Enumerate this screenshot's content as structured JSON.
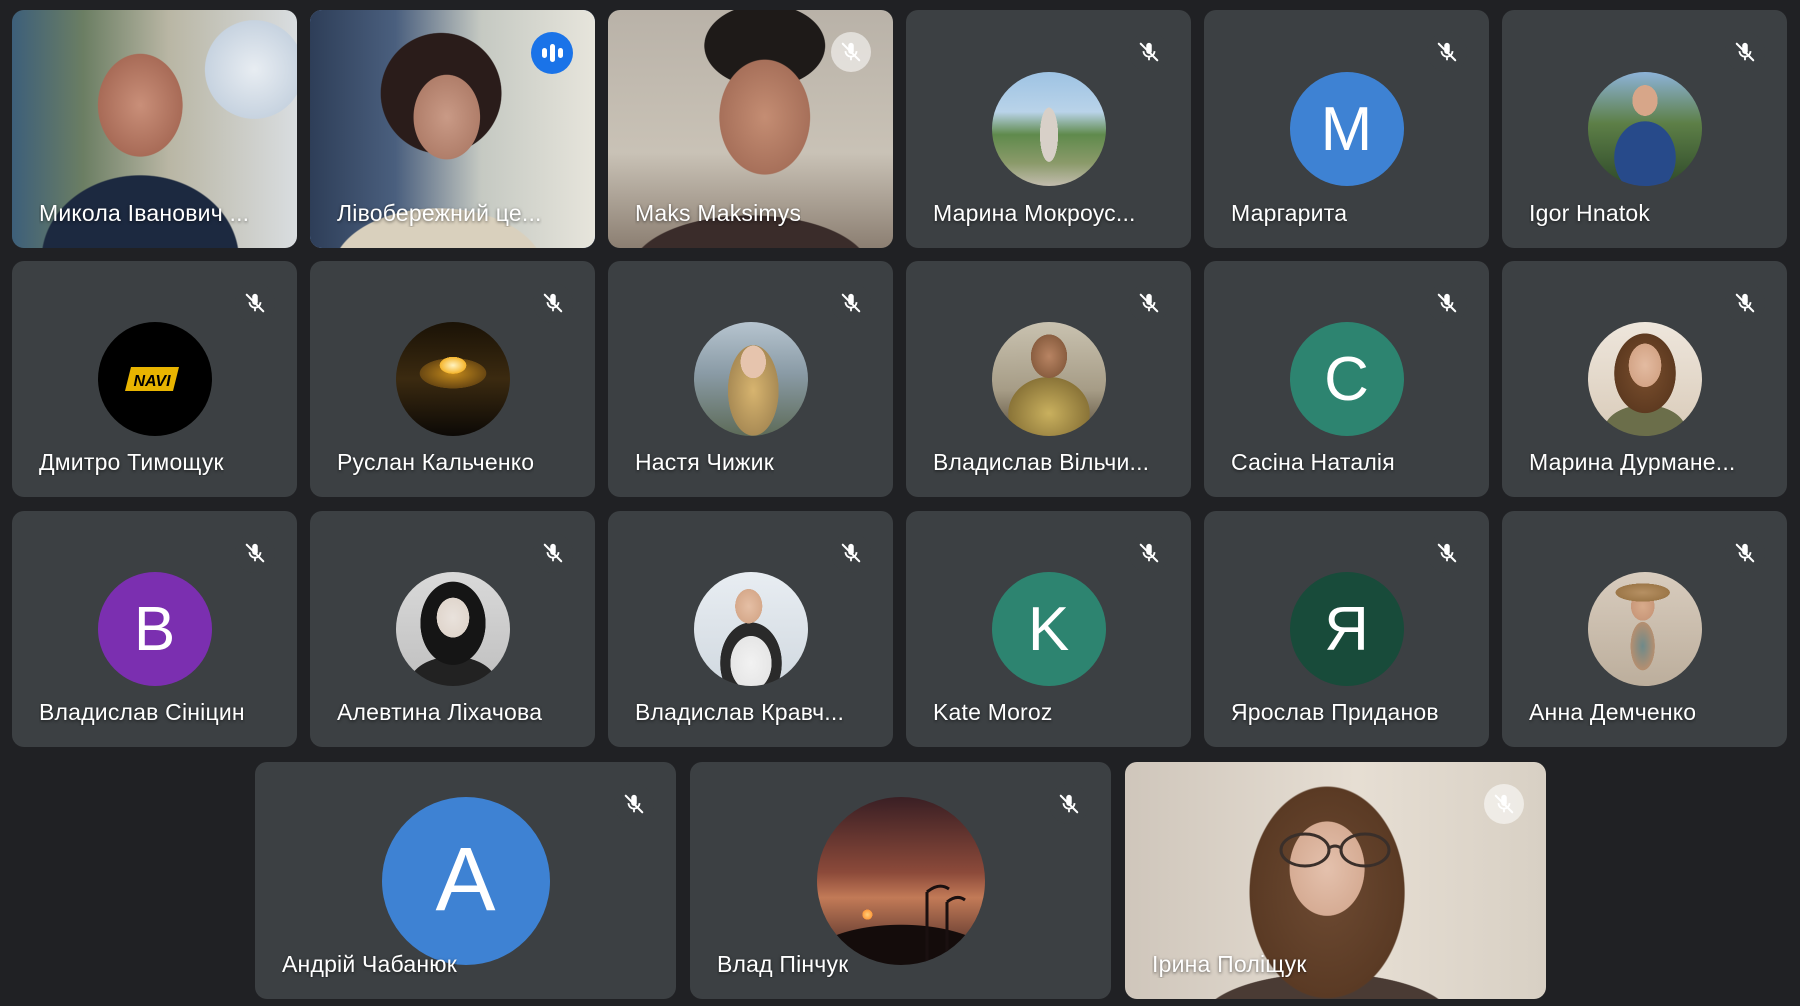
{
  "participants": [
    {
      "name": "Микола Іванович ...",
      "type": "video",
      "muted": false,
      "speaking": false,
      "icon": "man-in-suit-video"
    },
    {
      "name": "Лівобережний це...",
      "type": "video",
      "muted": false,
      "speaking": true,
      "icon": "woman-speaking-video"
    },
    {
      "name": "Maks Maksimys",
      "type": "video",
      "muted": true,
      "speaking": false,
      "icon": "man-with-glasses-video"
    },
    {
      "name": "Марина Мокроус...",
      "type": "photo",
      "muted": true,
      "speaking": false,
      "icon": "woman-on-path-photo",
      "color": "#6a8f5a"
    },
    {
      "name": "Маргарита",
      "type": "letter",
      "letter": "М",
      "muted": true,
      "speaking": false,
      "color": "#3e82d3"
    },
    {
      "name": "Igor Hnatok",
      "type": "photo",
      "muted": true,
      "speaking": false,
      "icon": "man-in-blue-suit-photo",
      "color": "#2f4a6a"
    },
    {
      "name": "Дмитро Тимощук",
      "type": "photo",
      "muted": true,
      "speaking": false,
      "icon": "navi-logo-photo",
      "color": "#000000"
    },
    {
      "name": "Руслан Кальченко",
      "type": "photo",
      "muted": true,
      "speaking": false,
      "icon": "car-headlight-photo",
      "color": "#3a2a10"
    },
    {
      "name": "Настя Чижик",
      "type": "photo",
      "muted": true,
      "speaking": false,
      "icon": "girl-by-lake-photo",
      "color": "#8a9ba6"
    },
    {
      "name": "Владислав Вільчи...",
      "type": "photo",
      "muted": true,
      "speaking": false,
      "icon": "bearded-man-photo",
      "color": "#7d6436"
    },
    {
      "name": "Сасіна Наталія",
      "type": "letter",
      "letter": "С",
      "muted": true,
      "speaking": false,
      "color": "#2d8470"
    },
    {
      "name": "Марина Дурмане...",
      "type": "photo",
      "muted": true,
      "speaking": false,
      "icon": "girl-portrait-photo",
      "color": "#b89a7c"
    },
    {
      "name": "Владислав Сініцин",
      "type": "letter",
      "letter": "В",
      "muted": true,
      "speaking": false,
      "color": "#7b2fb0"
    },
    {
      "name": "Алевтина Ліхачова",
      "type": "photo",
      "muted": true,
      "speaking": false,
      "icon": "girl-school-uniform-photo",
      "color": "#c9c9c9"
    },
    {
      "name": "Владислав Кравч...",
      "type": "photo",
      "muted": true,
      "speaking": false,
      "icon": "young-man-jacket-photo",
      "color": "#d6dde4"
    },
    {
      "name": "Kate Moroz",
      "type": "letter",
      "letter": "K",
      "muted": true,
      "speaking": false,
      "color": "#2d8470"
    },
    {
      "name": "Ярослав Приданов",
      "type": "letter",
      "letter": "Я",
      "muted": true,
      "speaking": false,
      "color": "#184b3a"
    },
    {
      "name": "Анна Демченко",
      "type": "photo",
      "muted": true,
      "speaking": false,
      "icon": "girl-with-hat-photo",
      "color": "#c4b6a4"
    },
    {
      "name": "Андрій Чабанюк",
      "type": "letter",
      "letter": "A",
      "muted": true,
      "speaking": false,
      "color": "#3e82d3"
    },
    {
      "name": "Влад Пінчук",
      "type": "photo",
      "muted": true,
      "speaking": false,
      "icon": "sunset-street-lamps-photo",
      "color": "#5a2c22"
    },
    {
      "name": "Ірина Поліщук",
      "type": "video",
      "muted": true,
      "speaking": false,
      "icon": "girl-with-glasses-video"
    }
  ],
  "colors": {
    "background": "#202124",
    "tile": "#3c4043",
    "speaking_outline": "#8ab4f8",
    "speaking_badge": "#1a73e8"
  }
}
